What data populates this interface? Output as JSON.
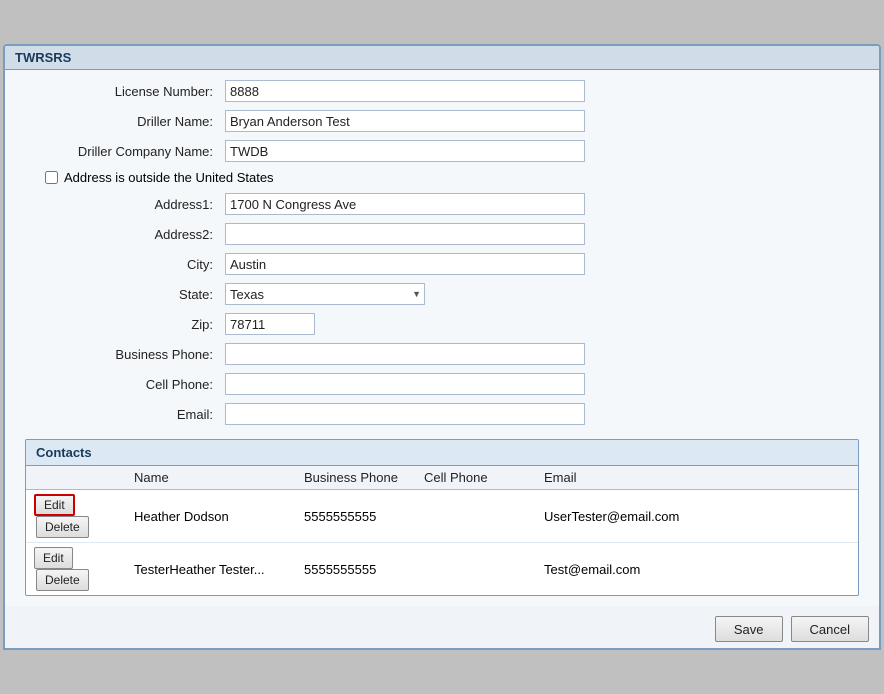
{
  "window": {
    "title": "TWRSRS"
  },
  "form": {
    "license_number_label": "License Number:",
    "license_number_value": "8888",
    "driller_name_label": "Driller Name:",
    "driller_name_value": "Bryan Anderson Test",
    "driller_company_label": "Driller Company Name:",
    "driller_company_value": "TWDB",
    "address_outside_label": "Address is outside the United States",
    "address1_label": "Address1:",
    "address1_value": "1700 N Congress Ave",
    "address2_label": "Address2:",
    "address2_value": "",
    "city_label": "City:",
    "city_value": "Austin",
    "state_label": "State:",
    "state_value": "Texas",
    "zip_label": "Zip:",
    "zip_value": "78711",
    "business_phone_label": "Business Phone:",
    "business_phone_value": "",
    "cell_phone_label": "Cell Phone:",
    "cell_phone_value": "",
    "email_label": "Email:",
    "email_value": ""
  },
  "contacts": {
    "header": "Contacts",
    "columns": {
      "name": "Name",
      "business_phone": "Business Phone",
      "cell_phone": "Cell Phone",
      "email": "Email"
    },
    "rows": [
      {
        "name": "Heather Dodson",
        "business_phone": "5555555555",
        "cell_phone": "",
        "email": "UserTester@email.com",
        "edit_highlighted": true
      },
      {
        "name": "TesterHeather Tester...",
        "business_phone": "5555555555",
        "cell_phone": "",
        "email": "Test@email.com",
        "edit_highlighted": false
      }
    ]
  },
  "buttons": {
    "edit": "Edit",
    "delete": "Delete",
    "save": "Save",
    "cancel": "Cancel"
  }
}
